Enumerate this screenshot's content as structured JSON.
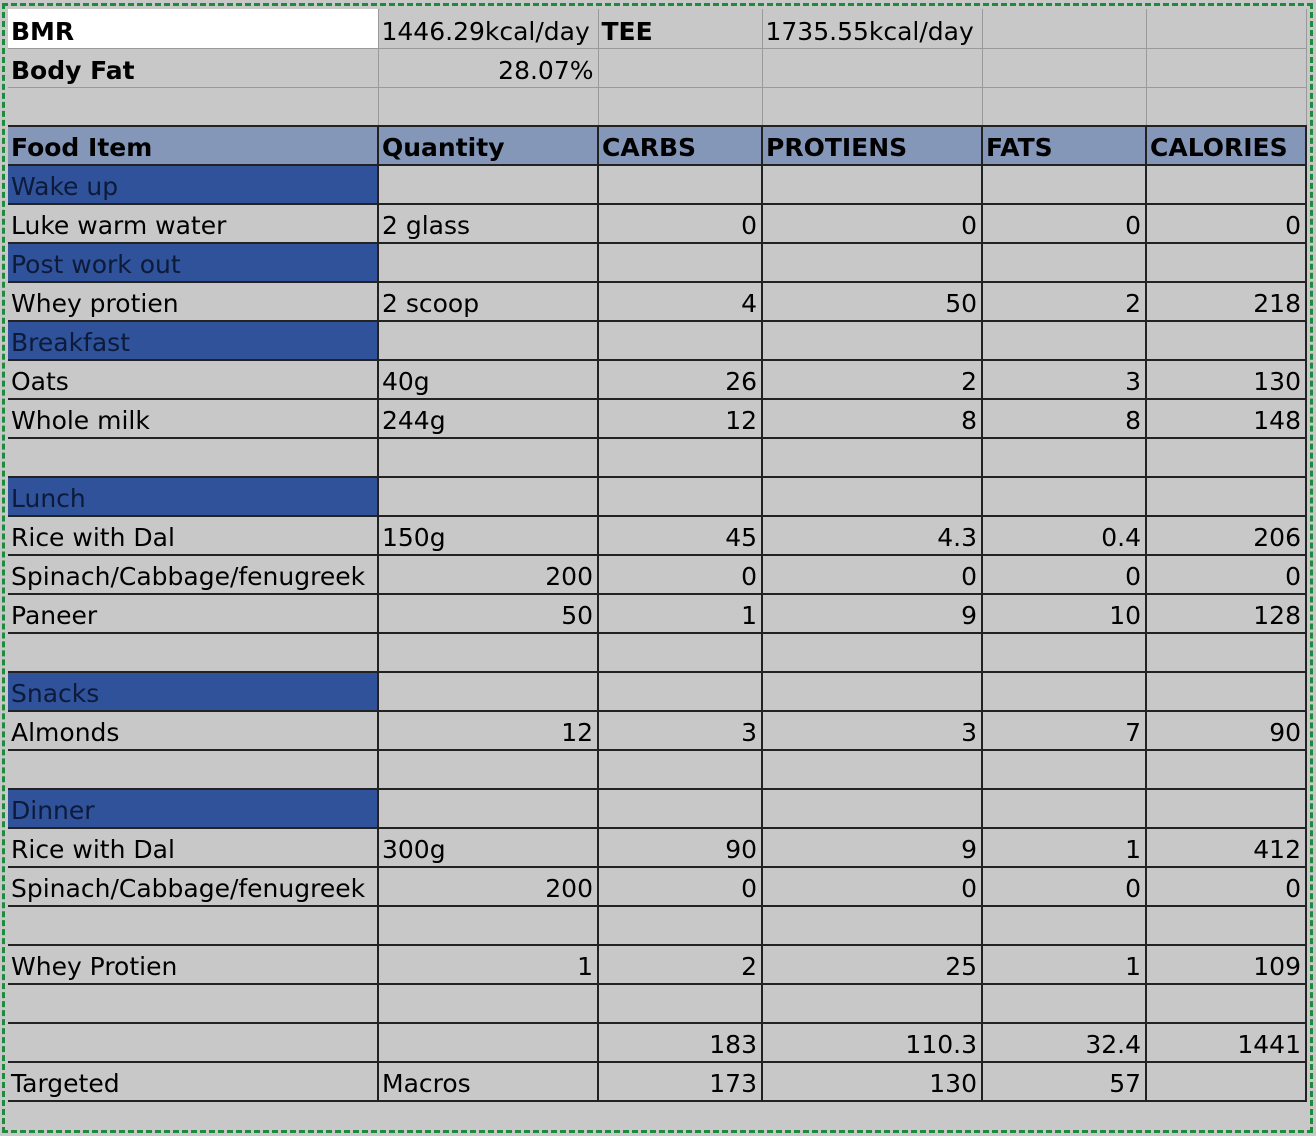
{
  "summary": {
    "bmr_label": "BMR",
    "bmr_value": "1446.29kcal/day",
    "tee_label": "TEE",
    "tee_value": "1735.55kcal/day",
    "bodyfat_label": "Body Fat",
    "bodyfat_value": "28.07%"
  },
  "headers": [
    "Food Item",
    "Quantity",
    "CARBS",
    "PROTIENS",
    "FATS",
    "CALORIES"
  ],
  "rows": [
    {
      "type": "section",
      "item": "Wake up"
    },
    {
      "type": "food",
      "item": "Luke warm water",
      "qty": "2 glass",
      "carbs": "0",
      "proteins": "0",
      "fats": "0",
      "calories": "0"
    },
    {
      "type": "section",
      "item": "Post work out"
    },
    {
      "type": "food",
      "item": "Whey protien",
      "qty": "2 scoop",
      "carbs": "4",
      "proteins": "50",
      "fats": "2",
      "calories": "218"
    },
    {
      "type": "section",
      "item": "Breakfast"
    },
    {
      "type": "food",
      "item": "Oats",
      "qty": "40g",
      "carbs": "26",
      "proteins": "2",
      "fats": "3",
      "calories": "130"
    },
    {
      "type": "food",
      "item": "Whole milk",
      "qty": "244g",
      "carbs": "12",
      "proteins": "8",
      "fats": "8",
      "calories": "148"
    },
    {
      "type": "blank"
    },
    {
      "type": "section",
      "item": "Lunch"
    },
    {
      "type": "food",
      "item": "Rice with Dal",
      "qty": "150g",
      "carbs": "45",
      "proteins": "4.3",
      "fats": "0.4",
      "calories": "206"
    },
    {
      "type": "food",
      "item": "Spinach/Cabbage/fenugreek",
      "qty": "200",
      "qtyNum": true,
      "carbs": "0",
      "proteins": "0",
      "fats": "0",
      "calories": "0"
    },
    {
      "type": "food",
      "item": "Paneer",
      "qty": "50",
      "qtyNum": true,
      "carbs": "1",
      "proteins": "9",
      "fats": "10",
      "calories": "128"
    },
    {
      "type": "blank"
    },
    {
      "type": "section",
      "item": "Snacks"
    },
    {
      "type": "food",
      "item": "Almonds",
      "qty": "12",
      "qtyNum": true,
      "carbs": "3",
      "proteins": "3",
      "fats": "7",
      "calories": "90"
    },
    {
      "type": "blank"
    },
    {
      "type": "section",
      "item": "Dinner"
    },
    {
      "type": "food",
      "item": "Rice with Dal",
      "qty": "300g",
      "carbs": "90",
      "proteins": "9",
      "fats": "1",
      "calories": "412"
    },
    {
      "type": "food",
      "item": "Spinach/Cabbage/fenugreek",
      "qty": "200",
      "qtyNum": true,
      "carbs": "0",
      "proteins": "0",
      "fats": "0",
      "calories": "0"
    },
    {
      "type": "blank"
    },
    {
      "type": "food",
      "item": "Whey Protien",
      "qty": "1",
      "qtyNum": true,
      "carbs": "2",
      "proteins": "25",
      "fats": "1",
      "calories": "109"
    },
    {
      "type": "blank"
    },
    {
      "type": "food",
      "item": "",
      "qty": "",
      "carbs": "183",
      "proteins": "110.3",
      "fats": "32.4",
      "calories": "1441"
    },
    {
      "type": "food",
      "item": "Targeted",
      "qty": "Macros",
      "carbs": "173",
      "proteins": "130",
      "fats": "57",
      "calories": ""
    }
  ]
}
